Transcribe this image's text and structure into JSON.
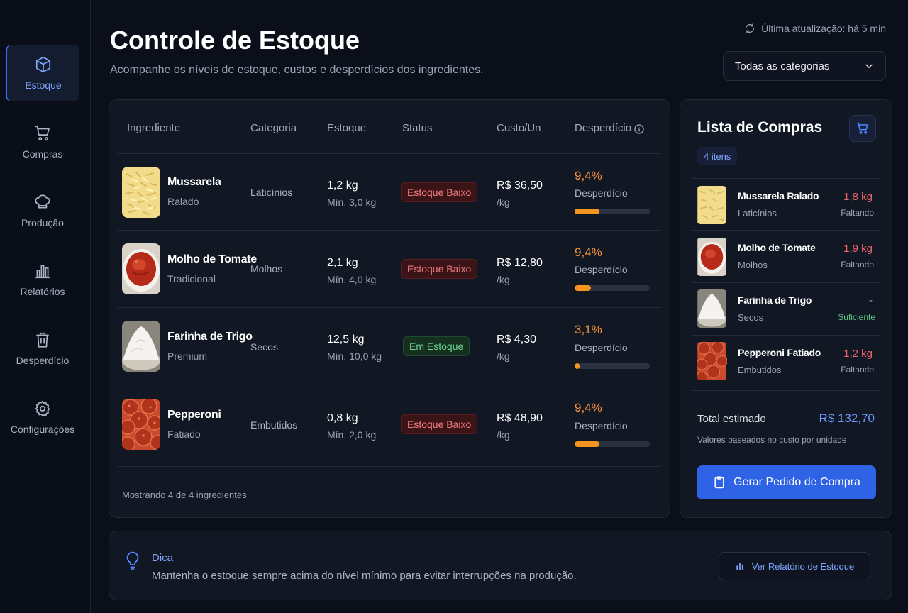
{
  "sidebar": {
    "items": [
      {
        "label": "Estoque",
        "icon": "box-icon",
        "active": true
      },
      {
        "label": "Compras",
        "icon": "cart-icon"
      },
      {
        "label": "Produção",
        "icon": "chef-hat-icon"
      },
      {
        "label": "Relatórios",
        "icon": "bar-chart-icon"
      },
      {
        "label": "Desperdício",
        "icon": "trash-icon"
      },
      {
        "label": "Configurações",
        "icon": "gear-icon"
      }
    ]
  },
  "header": {
    "title": "Controle de Estoque",
    "subtitle": "Acompanhe os níveis de estoque, custos e desperdícios dos ingredientes.",
    "last_update": "Última atualização: há 5 min",
    "category_select": "Todas as categorias"
  },
  "table": {
    "columns": [
      "Ingrediente",
      "Categoria",
      "Estoque",
      "Status",
      "Custo/Un",
      "Desperdício"
    ],
    "rows": [
      {
        "name": "Mussarela",
        "sub": "Ralado",
        "category": "Laticínios",
        "qty": "1,2 kg",
        "min": "Mín. 3,0 kg",
        "status": "Estoque Baixo",
        "price": "R$ 36,50",
        "unit": "/kg",
        "waste_pct": "9,4%",
        "waste_label": "Desperdício",
        "waste_level": 0.33
      },
      {
        "name": "Molho de Tomate",
        "sub": "Tradicional",
        "category": "Molhos",
        "qty": "2,1 kg",
        "min": "Mín. 4,0 kg",
        "status": "Estoque Baixo",
        "price": "R$ 12,80",
        "unit": "/kg",
        "waste_pct": "9,4%",
        "waste_label": "Desperdício",
        "waste_level": 0.22
      },
      {
        "name": "Farinha de Trigo",
        "sub": "Premium",
        "category": "Secos",
        "qty": "12,5 kg",
        "min": "Mín. 10,0 kg",
        "status": "Em Estoque",
        "price": "R$ 4,30",
        "unit": "/kg",
        "waste_pct": "3,1%",
        "waste_label": "Desperdício",
        "waste_level": 0.07
      },
      {
        "name": "Pepperoni",
        "sub": "Fatiado",
        "category": "Embutidos",
        "qty": "0,8 kg",
        "min": "Mín. 2,0 kg",
        "status": "Estoque Baixo",
        "price": "R$ 48,90",
        "unit": "/kg",
        "waste_pct": "9,4%",
        "waste_label": "Desperdício",
        "waste_level": 0.33
      }
    ],
    "footer": "Mostrando 4 de 4 ingredientes"
  },
  "shopping": {
    "title": "Lista de Compras",
    "count": "4 itens",
    "items": [
      {
        "name": "Mussarela Ralado",
        "category": "Laticínios",
        "qty": "1,8 kg",
        "state": "Faltando"
      },
      {
        "name": "Molho de Tomate",
        "category": "Molhos",
        "qty": "1,9 kg",
        "state": "Faltando"
      },
      {
        "name": "Farinha de Trigo",
        "category": "Secos",
        "qty": "-",
        "state": "Suficiente"
      },
      {
        "name": "Pepperoni Fatiado",
        "category": "Embutidos",
        "qty": "1,2 kg",
        "state": "Faltando"
      }
    ],
    "total_label": "Total estimado",
    "total_value": "R$ 132,70",
    "total_note": "Valores baseados no custo por unidade",
    "order_button": "Gerar Pedido de Compra"
  },
  "tip": {
    "title": "Dica",
    "text": "Mantenha o estoque sempre acima do nível mínimo para evitar interrupções na produção.",
    "button": "Ver Relatório de Estoque"
  },
  "colors": {
    "accent": "#2e63e6",
    "warning": "#f5923a",
    "danger": "#f0646c",
    "success": "#6fd494"
  }
}
